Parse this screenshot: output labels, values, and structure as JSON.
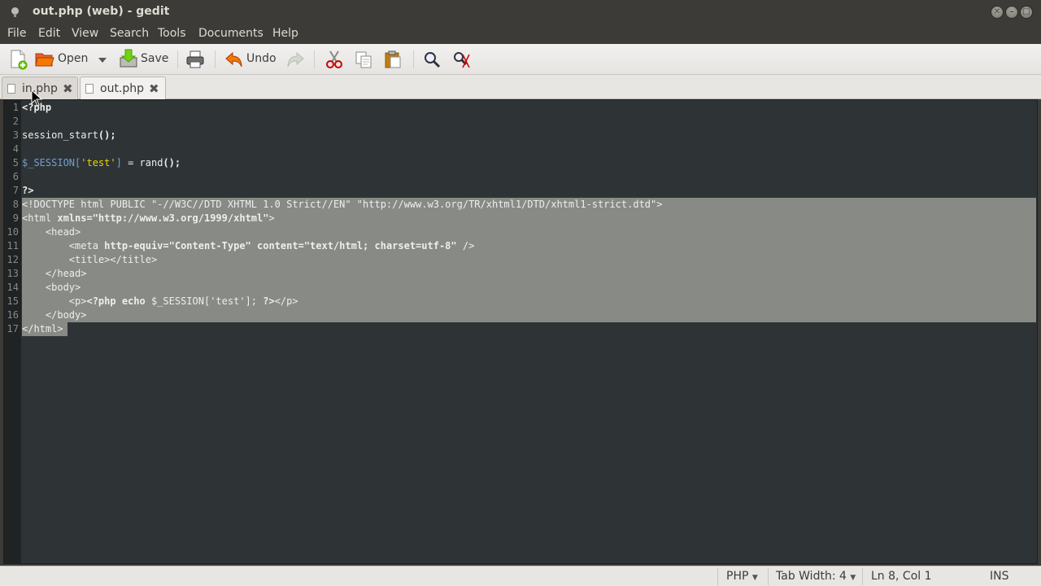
{
  "window": {
    "title": "out.php (web) - gedit"
  },
  "menu": {
    "items": [
      "File",
      "Edit",
      "View",
      "Search",
      "Tools",
      "Documents",
      "Help"
    ]
  },
  "toolbar": {
    "open_label": "Open",
    "save_label": "Save",
    "undo_label": "Undo"
  },
  "tabs": [
    {
      "label": "in.php",
      "active": false
    },
    {
      "label": "out.php",
      "active": true
    }
  ],
  "editor": {
    "line_numbers": [
      "1",
      "2",
      "3",
      "4",
      "5",
      "6",
      "7",
      "8",
      "9",
      "10",
      "11",
      "12",
      "13",
      "14",
      "15",
      "16",
      "17"
    ],
    "selected_from_line": 8,
    "selected_to_line": 17
  },
  "statusbar": {
    "language": "PHP",
    "tab_width": "Tab Width: 4",
    "position": "Ln 8, Col 1",
    "mode": "INS"
  },
  "colors": {
    "editor_bg": "#2e3436",
    "selection": "#888a85",
    "variable": "#729fcf",
    "string": "#edd400"
  }
}
